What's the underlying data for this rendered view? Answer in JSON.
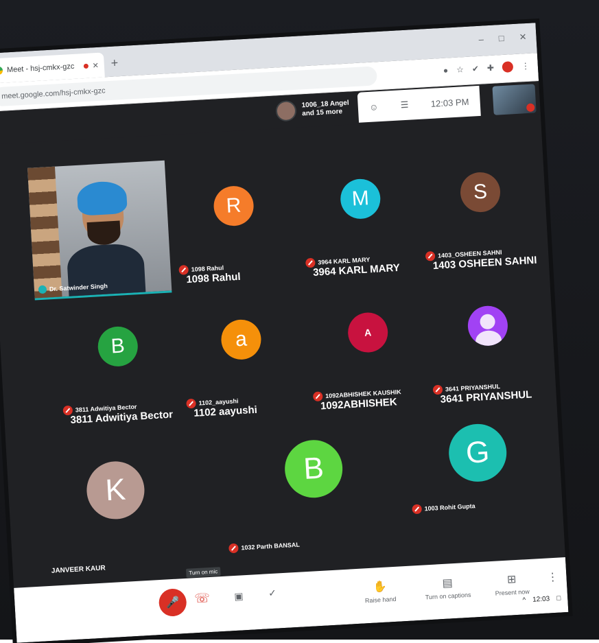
{
  "browser": {
    "tab_title": "Meet - hsj-cmkx-gzc",
    "url": "meet.google.com/hsj-cmkx-gzc",
    "window_controls": [
      "–",
      "□",
      "✕"
    ]
  },
  "meeting": {
    "people_chip": {
      "line1": "1006_18 Angel",
      "line2": "and 15 more"
    },
    "time": "12:03 PM",
    "top_icons": [
      "people-icon",
      "chat-icon"
    ]
  },
  "participants": [
    {
      "initial": "",
      "small_name": "",
      "big_name": "Dr. Satwinder Singh",
      "color": "#000000",
      "video": true
    },
    {
      "initial": "R",
      "small_name": "1098 Rahul",
      "big_name": "1098 Rahul",
      "color": "#f57c2a"
    },
    {
      "initial": "M",
      "small_name": "3964 KARL MARY",
      "big_name": "3964 KARL MARY",
      "color": "#1bc0d9"
    },
    {
      "initial": "S",
      "small_name": "1403_OSHEEN SAHNI",
      "big_name": "1403 OSHEEN SAHNI",
      "color": "#7a4a35"
    },
    {
      "initial": "B",
      "small_name": "3811 Adwitiya Bector",
      "big_name": "3811 Adwitiya Bector",
      "color": "#26a341"
    },
    {
      "initial": "a",
      "small_name": "1102_aayushi",
      "big_name": "1102 aayushi",
      "color": "#f5900a"
    },
    {
      "initial": "A",
      "small_name": "1092ABHISHEK KAUSHIK",
      "big_name": "1092ABHISHEK",
      "color": "#c8123f"
    },
    {
      "initial": "",
      "small_name": "3641 PRIYANSHUL",
      "big_name": "3641 PRIYANSHUL",
      "color": "#a142f4",
      "generic": true
    },
    {
      "initial": "K",
      "small_name": "",
      "big_name": "JANVEER KAUR",
      "color": "#b89a92"
    },
    {
      "initial": "B",
      "small_name": "1032 Parth BANSAL",
      "big_name": "",
      "color": "#5dd641"
    },
    {
      "initial": "G",
      "small_name": "1003 Rohit Gupta",
      "big_name": "",
      "color": "#1cbfb0"
    }
  ],
  "controls": {
    "tooltip": "Turn on mic",
    "raise_hand": "Raise hand",
    "captions": "Turn on captions",
    "present": "Present now"
  },
  "taskbar": {
    "clock": "12:03"
  }
}
